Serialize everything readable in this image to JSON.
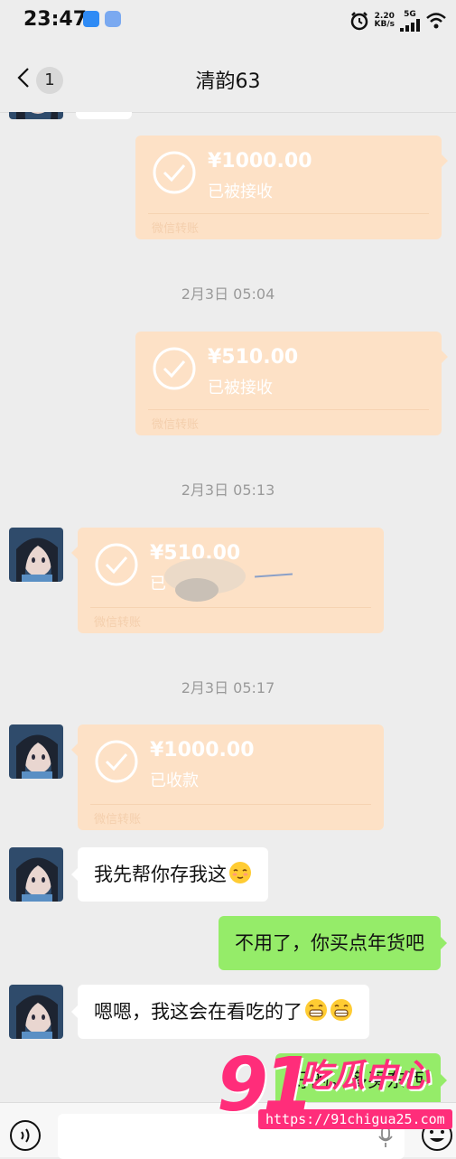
{
  "status_bar": {
    "time": "23:47",
    "net_speed_value": "2.20",
    "net_speed_unit": "KB/s",
    "network": "5G",
    "icons": [
      "alarm-icon",
      "signal-icon",
      "wifi-icon"
    ]
  },
  "nav": {
    "title": "清韵63",
    "unread_count": "1"
  },
  "messages": {
    "m1": {
      "amount": "¥1000.00",
      "status": "已被接收",
      "footer": "微信转账"
    },
    "t1": "2月3日 05:04",
    "m2": {
      "amount": "¥510.00",
      "status": "已被接收",
      "footer": "微信转账"
    },
    "t2": "2月3日 05:13",
    "m3": {
      "amount": "¥510.00",
      "status": "已",
      "footer": "微信转账"
    },
    "t3": "2月3日 05:17",
    "m4": {
      "amount": "¥1000.00",
      "status": "已收款",
      "footer": "微信转账"
    },
    "m5": {
      "text": "我先帮你存我这",
      "emoji": "relieved-face-emoji"
    },
    "m6": {
      "text": "不用了，你买点年货吧"
    },
    "m7": {
      "text": "嗯嗯，我这会在看吃的了",
      "emoji": "grinning-face-emoji"
    },
    "m8": {
      "text": "好的，多买东西"
    }
  },
  "watermark": {
    "number": "91",
    "text": "吃瓜中心",
    "url": "https://91chigua25.com"
  },
  "colors": {
    "background": "#ededed",
    "transfer_bubble": "#fde1c6",
    "sent_bubble": "#95ec69",
    "received_bubble": "#ffffff",
    "watermark": "#ff2d7a"
  }
}
